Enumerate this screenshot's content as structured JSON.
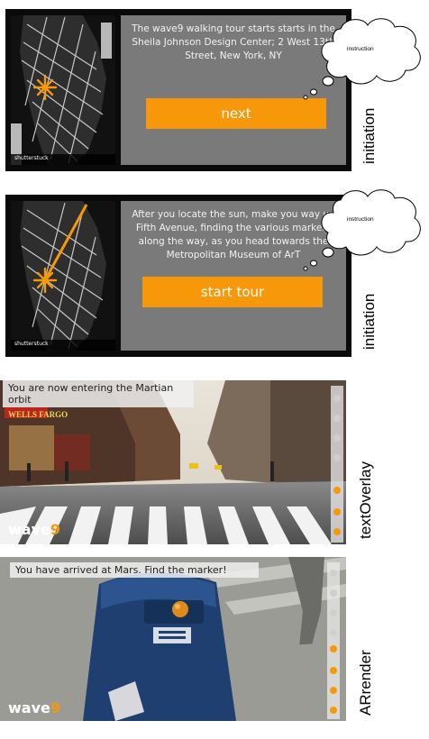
{
  "panels": [
    {
      "message": "The wave9 walking tour starts starts in the Sheila Johnson Design Center; 2 West 13th Street, New York, NY",
      "button_label": "next",
      "map_credit": "shutterstuck",
      "cloud_label": "instruction",
      "side_label": "initiation"
    },
    {
      "message": "After you locate the sun, make you way up Fifth Avenue, finding the various markers along the way, as you head towards the Metropolitan Museum of ArT",
      "button_label": "start tour",
      "map_credit": "shutterstuck",
      "cloud_label": "instruction",
      "side_label": "initiation"
    }
  ],
  "text_overlay": {
    "overlay_text": "You are now entering the Martian orbit",
    "logo_wave": "wave",
    "logo_nine": "9",
    "storefront_sign": "WELLS FARGO",
    "side_label": "textOverlay"
  },
  "ar_render": {
    "overlay_text": "You have arrived at Mars. Find the marker!",
    "logo_wave": "wave",
    "logo_nine": "9",
    "side_label": "ARrender"
  },
  "colors": {
    "accent": "#f7980b",
    "screen_gray": "#7a7a7a",
    "frame": "#0a0a0a"
  }
}
